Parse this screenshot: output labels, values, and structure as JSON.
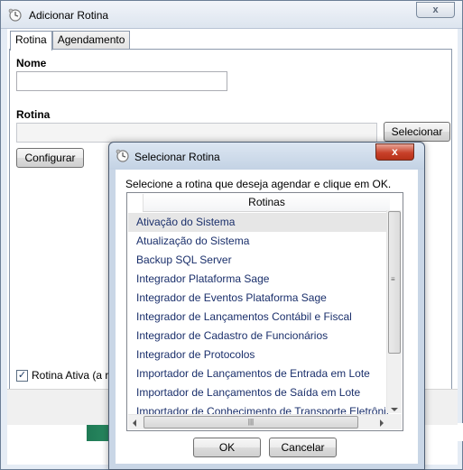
{
  "main_window": {
    "title": "Adicionar Rotina",
    "close_glyph": "x",
    "tabs": [
      {
        "label": "Rotina",
        "active": true
      },
      {
        "label": "Agendamento",
        "active": false
      }
    ],
    "nome_label": "Nome",
    "nome_value": "",
    "rotina_label": "Rotina",
    "rotina_value": "",
    "selecionar_button": "Selecionar",
    "configurar_button": "Configurar",
    "rotina_ativa_label": "Rotina Ativa (a r",
    "rotina_ativa_checked": true
  },
  "dialog": {
    "title": "Selecionar Rotina",
    "close_glyph": "x",
    "instruction": "Selecione a rotina que deseja agendar e clique em OK.",
    "list_header": "Rotinas",
    "items": [
      "Ativação do Sistema",
      "Atualização do Sistema",
      "Backup SQL Server",
      "Integrador Plataforma Sage",
      "Integrador de Eventos Plataforma Sage",
      "Integrador de Lançamentos Contábil e Fiscal",
      "Integrador de Cadastro de Funcionários",
      "Integrador de Protocolos",
      "Importador de Lançamentos de Entrada em Lote",
      "Importador de Lançamentos de Saída em Lote",
      "Importador de Conhecimento de Transporte Eletrônico"
    ],
    "selected_index": 0,
    "ok_button": "OK",
    "cancel_button": "Cancelar"
  },
  "icons": {
    "app": "gear-clock-icon",
    "check": "checkmark-icon"
  }
}
